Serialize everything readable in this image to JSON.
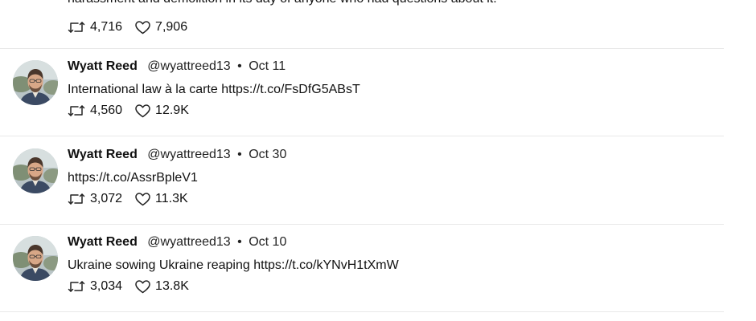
{
  "top_fragment": {
    "text": "harassment and demolition in its day of anyone who had questions about it.",
    "retweets": "4,716",
    "likes": "7,906"
  },
  "tweets": [
    {
      "name": "Wyatt Reed",
      "handle": "@wyattreed13",
      "separator": "•",
      "date": "Oct 11",
      "text": "International law à la carte https://t.co/FsDfG5ABsT",
      "retweets": "4,560",
      "likes": "12.9K"
    },
    {
      "name": "Wyatt Reed",
      "handle": "@wyattreed13",
      "separator": "•",
      "date": "Oct 30",
      "text": "https://t.co/AssrBpleV1",
      "retweets": "3,072",
      "likes": "11.3K"
    },
    {
      "name": "Wyatt Reed",
      "handle": "@wyattreed13",
      "separator": "•",
      "date": "Oct 10",
      "text": "Ukraine sowing Ukraine reaping https://t.co/kYNvH1tXmW",
      "retweets": "3,034",
      "likes": "13.8K"
    }
  ],
  "icons": {
    "retweet": "retweet-icon",
    "like": "heart-icon"
  },
  "colors": {
    "divider": "#e8e8e8",
    "text": "#111111"
  }
}
